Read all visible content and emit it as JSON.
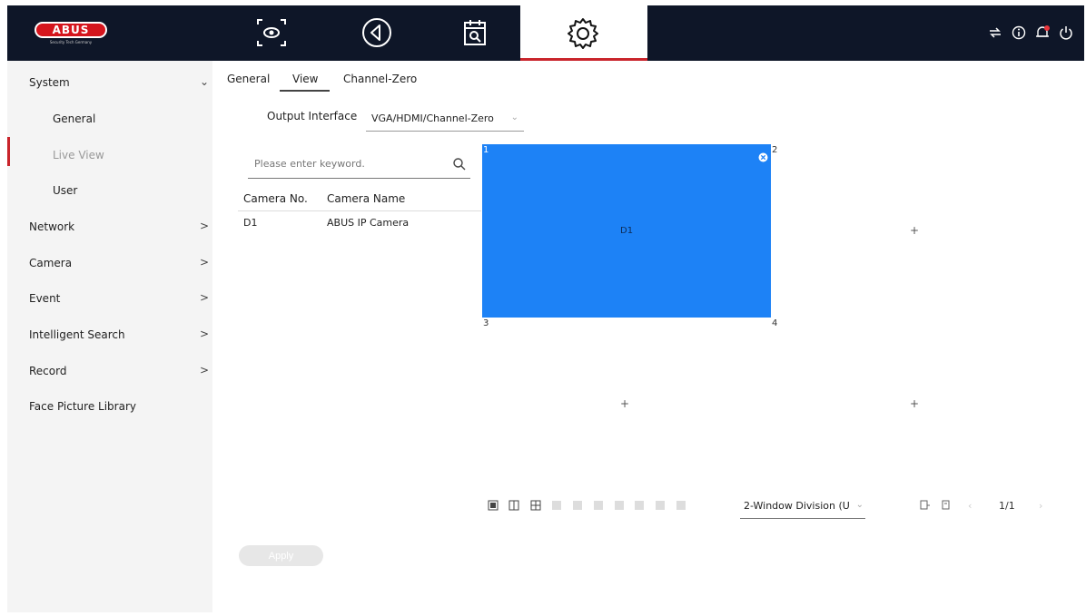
{
  "header": {
    "logo_text": "ABUS",
    "logo_tagline": "Security Tech Germany",
    "nav": [
      {
        "icon": "live-view-icon"
      },
      {
        "icon": "playback-icon"
      },
      {
        "icon": "search-calendar-icon"
      },
      {
        "icon": "settings-gear-icon",
        "active": true
      }
    ],
    "right_icons": [
      "network-icon",
      "info-icon",
      "alarm-bell-icon",
      "power-icon"
    ]
  },
  "sidebar": {
    "items": [
      {
        "label": "System",
        "arrow": "⌄"
      },
      {
        "label": "General",
        "arrow": ""
      },
      {
        "label": "Live View",
        "arrow": "",
        "active": true
      },
      {
        "label": "User",
        "arrow": ""
      },
      {
        "label": "Network",
        "arrow": ">"
      },
      {
        "label": "Camera",
        "arrow": ">"
      },
      {
        "label": "Event",
        "arrow": ">"
      },
      {
        "label": "Intelligent Search",
        "arrow": ">"
      },
      {
        "label": "Record",
        "arrow": ">"
      },
      {
        "label": "Face Picture Library",
        "arrow": ""
      }
    ]
  },
  "tabs": [
    {
      "label": "General"
    },
    {
      "label": "View",
      "active": true
    },
    {
      "label": "Channel-Zero"
    }
  ],
  "output": {
    "label": "Output Interface",
    "value": "VGA/HDMI/Channel-Zero"
  },
  "search": {
    "placeholder": "Please enter keyword."
  },
  "camera_table": {
    "headers": [
      "Camera No.",
      "Camera Name"
    ],
    "rows": [
      [
        "D1",
        "ABUS IP Camera"
      ]
    ]
  },
  "windows": [
    {
      "num": "1",
      "camera": "D1",
      "selected": true
    },
    {
      "num": "2",
      "camera": "",
      "selected": false
    },
    {
      "num": "3",
      "camera": "",
      "selected": false
    },
    {
      "num": "4",
      "camera": "",
      "selected": false
    }
  ],
  "layout_toolbar": {
    "division": "2-Window Division (U",
    "page": "1/1"
  },
  "apply_label": "Apply",
  "colors": {
    "accent": "#c9242b",
    "selected_window": "#1d82f6",
    "header_bg": "#0e1628"
  }
}
